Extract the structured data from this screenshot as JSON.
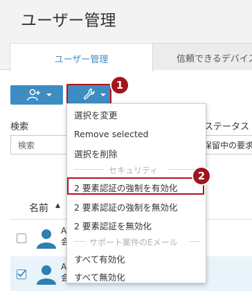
{
  "page": {
    "title": "ユーザー管理"
  },
  "tabs": [
    {
      "label": "ユーザー管理",
      "active": true
    },
    {
      "label": "信頼できるデバイス",
      "active": false
    }
  ],
  "toolbar": {
    "add_user_icon": "add-user-icon",
    "tools_icon": "wrench-icon",
    "accent_color": "#3d8dc3"
  },
  "search": {
    "label": "検索",
    "placeholder": "検索"
  },
  "status_filter": {
    "label": "ステータス",
    "value": "保留中の要求"
  },
  "table": {
    "name_header": "名前",
    "rows": [
      {
        "name": "A",
        "sub": "会",
        "checked": false
      },
      {
        "name": "A",
        "sub": "会",
        "checked": true
      }
    ]
  },
  "menu": {
    "change_selected": "選択を変更",
    "remove_selected": "Remove selected",
    "delete_selected": "選択を削除",
    "security_header": "セキュリティ",
    "enforce_2fa_on": "2 要素認証の強制を有効化",
    "enforce_2fa_off": "2 要素認証の強制を無効化",
    "disable_2fa": "2 要素認証を無効化",
    "support_email_header": "サポート案件のEメール",
    "enable_all": "すべて有効化",
    "disable_all": "すべて無効化"
  },
  "callouts": {
    "one": "1",
    "two": "2"
  },
  "highlight_color": "#b5121b"
}
